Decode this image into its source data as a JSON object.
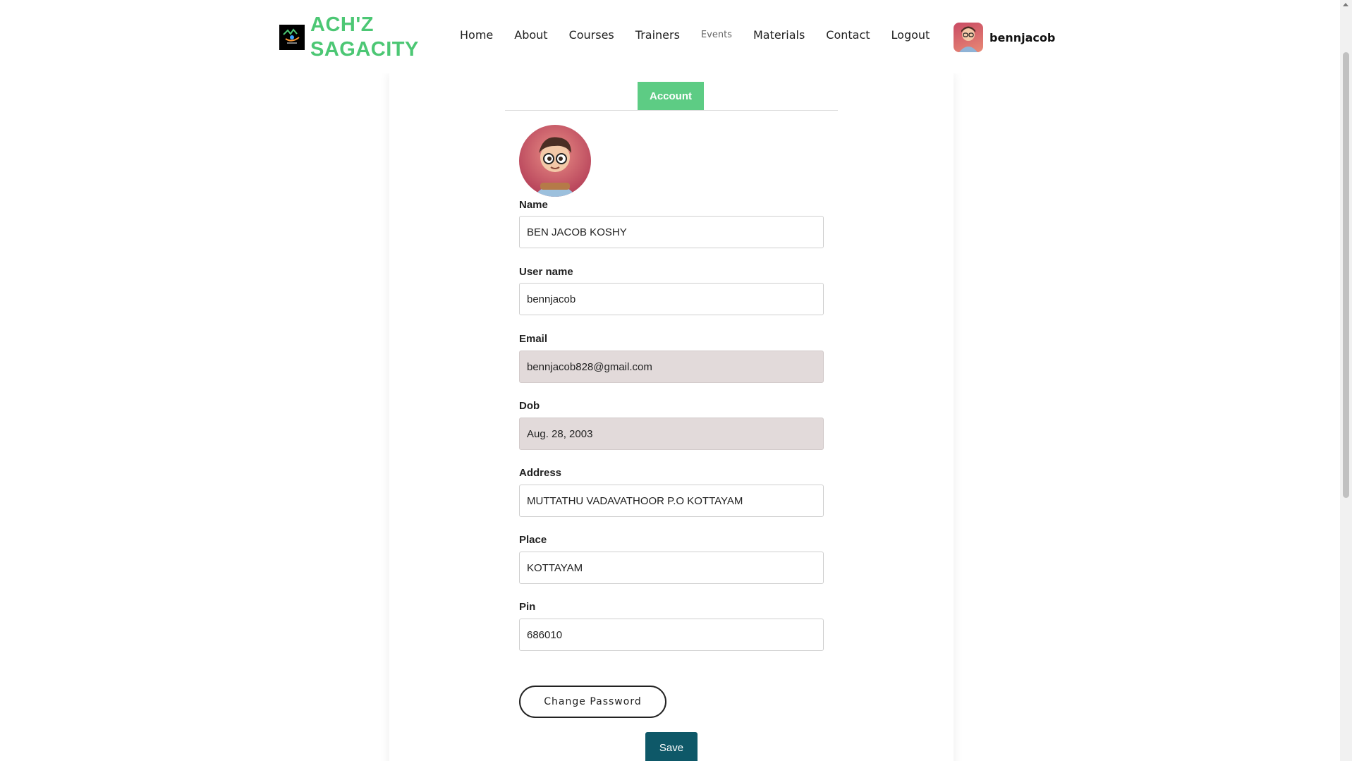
{
  "brand": {
    "line1": "ACH'Z",
    "line2": "SAGACITY",
    "logo_icon": "brand-logo-icon",
    "color": "#4cc774"
  },
  "nav": {
    "items": [
      {
        "label": "Home"
      },
      {
        "label": "About"
      },
      {
        "label": "Courses"
      },
      {
        "label": "Trainers"
      },
      {
        "label": "Events"
      },
      {
        "label": "Materials"
      },
      {
        "label": "Contact"
      },
      {
        "label": "Logout"
      }
    ]
  },
  "user": {
    "username": "bennjacob",
    "avatar_icon": "user-avatar-icon"
  },
  "tabs": {
    "account": "Account",
    "accent": "#5dcc84"
  },
  "profile": {
    "avatar_icon": "profile-avatar-icon"
  },
  "form": {
    "name": {
      "label": "Name",
      "value": "BEN JACOB KOSHY"
    },
    "username": {
      "label": "User name",
      "value": "bennjacob"
    },
    "email": {
      "label": "Email",
      "value": "bennjacob828@gmail.com",
      "disabled": true
    },
    "dob": {
      "label": "Dob",
      "value": "Aug. 28, 2003",
      "disabled": true
    },
    "address": {
      "label": "Address",
      "value": "MUTTATHU VADAVATHOOR P.O KOTTAYAM"
    },
    "place": {
      "label": "Place",
      "value": "KOTTAYAM"
    },
    "pin": {
      "label": "Pin",
      "value": "686010"
    }
  },
  "actions": {
    "change_password": "Change Password",
    "save": "Save",
    "save_color": "#0e5868"
  }
}
